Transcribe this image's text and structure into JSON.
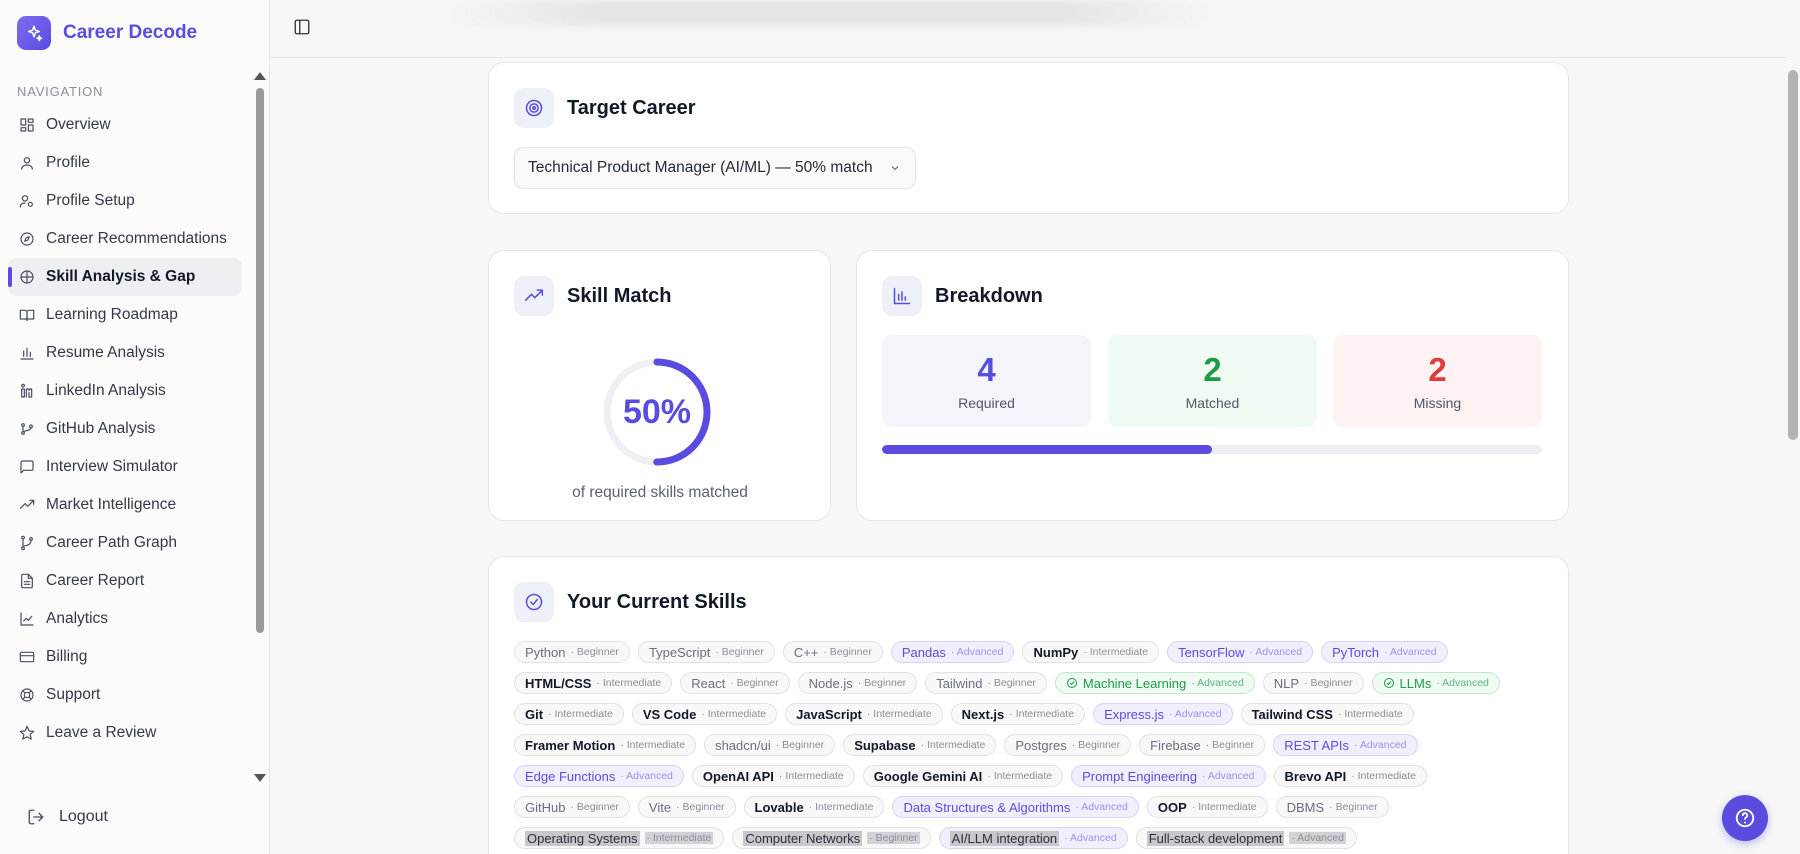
{
  "app": {
    "name": "Career Decode"
  },
  "nav": {
    "title": "NAVIGATION",
    "items": [
      {
        "label": "Overview",
        "icon": "grid-icon"
      },
      {
        "label": "Profile",
        "icon": "user-icon"
      },
      {
        "label": "Profile Setup",
        "icon": "user-gear-icon"
      },
      {
        "label": "Career Recommendations",
        "icon": "compass-icon"
      },
      {
        "label": "Skill Analysis & Gap",
        "icon": "brain-icon",
        "active": true
      },
      {
        "label": "Learning Roadmap",
        "icon": "book-icon"
      },
      {
        "label": "Resume Analysis",
        "icon": "bar-chart-icon"
      },
      {
        "label": "LinkedIn Analysis",
        "icon": "linkedin-icon"
      },
      {
        "label": "GitHub Analysis",
        "icon": "github-icon"
      },
      {
        "label": "Interview Simulator",
        "icon": "chat-icon"
      },
      {
        "label": "Market Intelligence",
        "icon": "trend-icon"
      },
      {
        "label": "Career Path Graph",
        "icon": "branch-icon"
      },
      {
        "label": "Career Report",
        "icon": "file-icon"
      },
      {
        "label": "Analytics",
        "icon": "line-chart-icon"
      },
      {
        "label": "Billing",
        "icon": "card-icon"
      },
      {
        "label": "Support",
        "icon": "lifebuoy-icon"
      },
      {
        "label": "Leave a Review",
        "icon": "star-icon"
      }
    ],
    "logout": "Logout"
  },
  "target": {
    "title": "Target Career",
    "selected": "Technical Product Manager (AI/ML) — 50% match"
  },
  "skill_match": {
    "title": "Skill Match",
    "percent_label": "50%",
    "percent": 0.5,
    "caption": "of required skills matched"
  },
  "breakdown": {
    "title": "Breakdown",
    "required": {
      "value": "4",
      "label": "Required"
    },
    "matched": {
      "value": "2",
      "label": "Matched"
    },
    "missing": {
      "value": "2",
      "label": "Missing"
    },
    "progress": 0.5
  },
  "skills": {
    "title": "Your Current Skills",
    "items": [
      {
        "name": "Python",
        "level": "· Beginner",
        "style": "muted"
      },
      {
        "name": "TypeScript",
        "level": "· Beginner",
        "style": "muted"
      },
      {
        "name": "C++",
        "level": "· Beginner",
        "style": "muted"
      },
      {
        "name": "Pandas",
        "level": "· Advanced",
        "style": "purple"
      },
      {
        "name": "NumPy",
        "level": "· Intermediate",
        "style": "dark"
      },
      {
        "name": "TensorFlow",
        "level": "· Advanced",
        "style": "purple"
      },
      {
        "name": "PyTorch",
        "level": "· Advanced",
        "style": "purple"
      },
      {
        "name": "HTML/CSS",
        "level": "· Intermediate",
        "style": "dark"
      },
      {
        "name": "React",
        "level": "· Beginner",
        "style": "muted"
      },
      {
        "name": "Node.js",
        "level": "· Beginner",
        "style": "muted"
      },
      {
        "name": "Tailwind",
        "level": "· Beginner",
        "style": "muted"
      },
      {
        "name": "Machine Learning",
        "level": "· Advanced",
        "style": "green"
      },
      {
        "name": "NLP",
        "level": "· Beginner",
        "style": "muted"
      },
      {
        "name": "LLMs",
        "level": "· Advanced",
        "style": "green"
      },
      {
        "name": "Git",
        "level": "· Intermediate",
        "style": "dark"
      },
      {
        "name": "VS Code",
        "level": "· Intermediate",
        "style": "dark"
      },
      {
        "name": "JavaScript",
        "level": "· Intermediate",
        "style": "dark"
      },
      {
        "name": "Next.js",
        "level": "· Intermediate",
        "style": "dark"
      },
      {
        "name": "Express.js",
        "level": "· Advanced",
        "style": "purple"
      },
      {
        "name": "Tailwind CSS",
        "level": "· Intermediate",
        "style": "dark"
      },
      {
        "name": "Framer Motion",
        "level": "· Intermediate",
        "style": "dark"
      },
      {
        "name": "shadcn/ui",
        "level": "· Beginner",
        "style": "muted"
      },
      {
        "name": "Supabase",
        "level": "· Intermediate",
        "style": "dark"
      },
      {
        "name": "Postgres",
        "level": "· Beginner",
        "style": "muted"
      },
      {
        "name": "Firebase",
        "level": "· Beginner",
        "style": "muted"
      },
      {
        "name": "REST APIs",
        "level": "· Advanced",
        "style": "purple"
      },
      {
        "name": "Edge Functions",
        "level": "· Advanced",
        "style": "purple"
      },
      {
        "name": "OpenAI API",
        "level": "· Intermediate",
        "style": "dark"
      },
      {
        "name": "Google Gemini AI",
        "level": "· Intermediate",
        "style": "dark"
      },
      {
        "name": "Prompt Engineering",
        "level": "· Advanced",
        "style": "purple"
      },
      {
        "name": "Brevo API",
        "level": "· Intermediate",
        "style": "dark"
      },
      {
        "name": "GitHub",
        "level": "· Beginner",
        "style": "muted"
      },
      {
        "name": "Vite",
        "level": "· Beginner",
        "style": "muted"
      },
      {
        "name": "Lovable",
        "level": "· Intermediate",
        "style": "dark"
      },
      {
        "name": "Data Structures & Algorithms",
        "level": "· Advanced",
        "style": "purple"
      },
      {
        "name": "OOP",
        "level": "· Intermediate",
        "style": "dark"
      },
      {
        "name": "DBMS",
        "level": "· Beginner",
        "style": "muted"
      },
      {
        "name": "Operating Systems",
        "level": "· Intermediate",
        "style": "hl"
      },
      {
        "name": "Computer Networks",
        "level": "· Beginner",
        "style": "hl"
      },
      {
        "name": "AI/LLM integration",
        "level": "· Advanced",
        "style": "hl-purple"
      },
      {
        "name": "Full-stack development",
        "level": "· Advanced",
        "style": "hl"
      }
    ]
  },
  "colors": {
    "accent": "#5b4ce0",
    "matched": "#1f9a48",
    "missing": "#e03c3c"
  }
}
